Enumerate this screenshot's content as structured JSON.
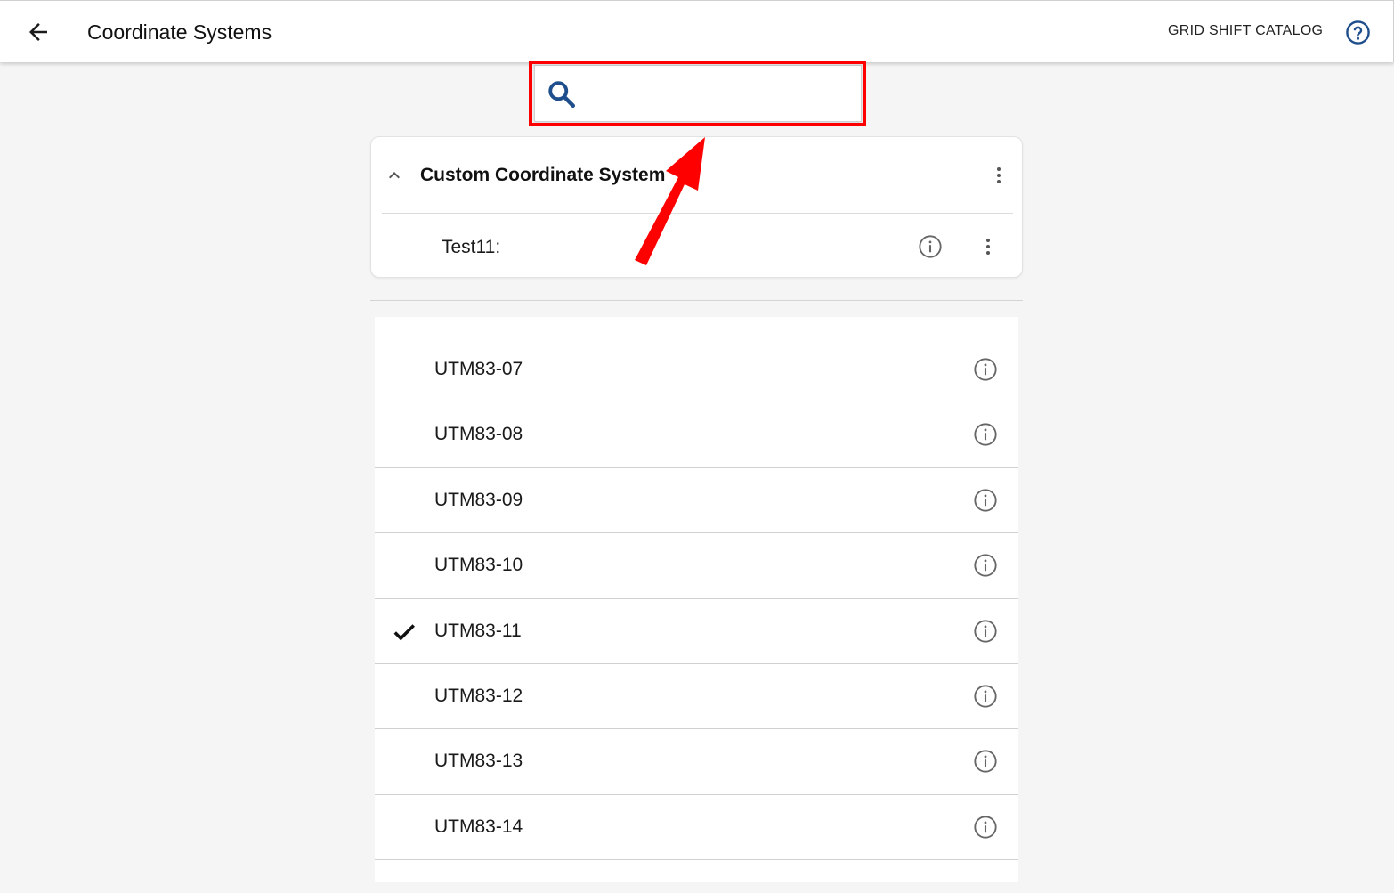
{
  "app_bar": {
    "title": "Coordinate Systems",
    "back_icon": "arrow-left-icon",
    "grid_shift_label": "GRID SHIFT CATALOG",
    "help_icon": "help-circle-icon"
  },
  "search": {
    "icon": "search-icon",
    "value": "",
    "placeholder": ""
  },
  "custom_section": {
    "title": "Custom Coordinate System",
    "expanded": true,
    "items": [
      {
        "label": "Test11:"
      }
    ]
  },
  "list": {
    "items": [
      {
        "label": "UTM83-07",
        "selected": false
      },
      {
        "label": "UTM83-08",
        "selected": false
      },
      {
        "label": "UTM83-09",
        "selected": false
      },
      {
        "label": "UTM83-10",
        "selected": false
      },
      {
        "label": "UTM83-11",
        "selected": true
      },
      {
        "label": "UTM83-12",
        "selected": false
      },
      {
        "label": "UTM83-13",
        "selected": false
      },
      {
        "label": "UTM83-14",
        "selected": false
      }
    ]
  },
  "annotation": {
    "highlight_color": "#ff0000"
  },
  "colors": {
    "accent": "#1f4e8c",
    "icon_gray": "#666666",
    "background": "#f5f5f5"
  }
}
